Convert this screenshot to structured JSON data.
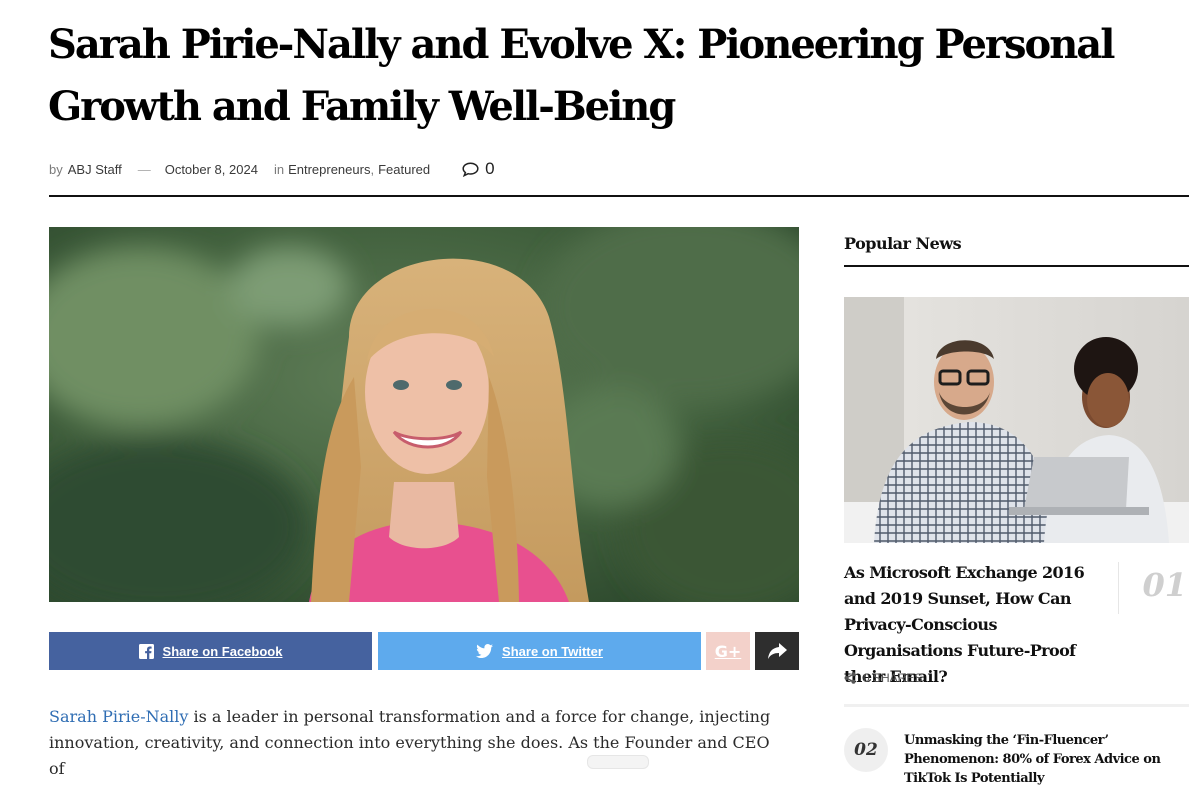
{
  "article": {
    "title": "Sarah Pirie-Nally and Evolve X: Pioneering Personal Growth and Family Well-Being",
    "by_label": "by",
    "author": "ABJ Staff",
    "date_separator": "—",
    "date": "October 8, 2024",
    "in_label": "in",
    "categories": [
      "Entrepreneurs",
      "Featured"
    ],
    "category_separator": ",",
    "comment_count": "0",
    "body_link": "Sarah Pirie-Nally",
    "body_text": " is a leader in personal transformation and a force for change, injecting innovation, creativity, and connection into everything she does. As the Founder and CEO of"
  },
  "share": {
    "facebook_label": "Share on Facebook",
    "twitter_label": "Share on Twitter",
    "colors": {
      "facebook": "#45629f",
      "twitter": "#5eaaed",
      "google": "#f3d1ca",
      "more": "#2e2e2e"
    }
  },
  "sidebar": {
    "title": "Popular News",
    "items": [
      {
        "number": "01",
        "title": "As Microsoft Exchange 2016 and 2019 Sunset, How Can Privacy-Conscious Organisations Future-Proof their Email?",
        "shares": "0 SHARES"
      },
      {
        "number": "02",
        "title": "Unmasking the ‘Fin-Fluencer’ Phenomenon: 80% of Forex Advice on TikTok Is Potentially"
      }
    ]
  },
  "icons": {
    "facebook": "facebook-icon",
    "twitter": "twitter-icon",
    "google_plus": "google-plus-icon",
    "share_arrow": "share-arrow-icon",
    "comment": "comment-icon",
    "share_nodes": "share-nodes-icon"
  }
}
